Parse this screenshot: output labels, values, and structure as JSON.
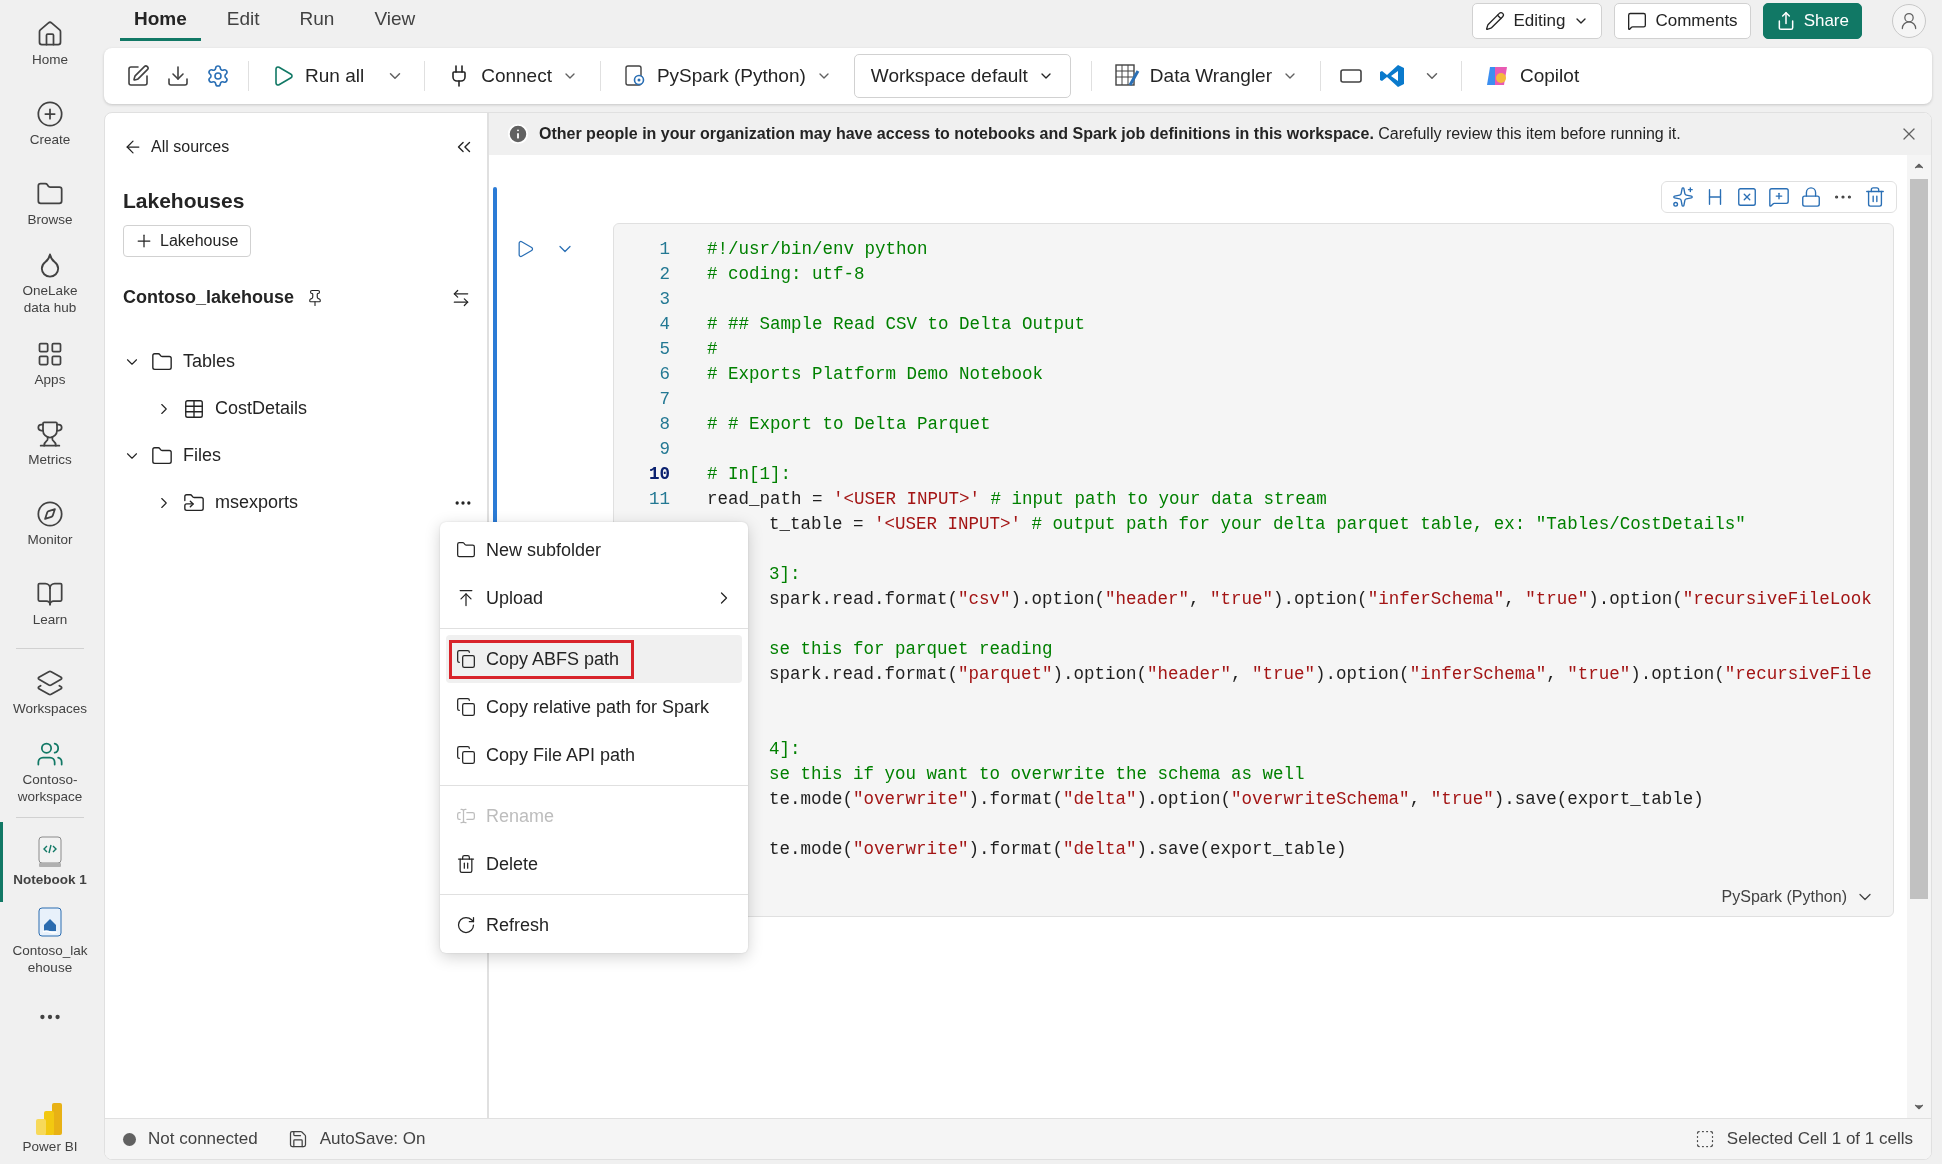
{
  "nav_rail": {
    "items": [
      {
        "label": "Home",
        "selected": false
      },
      {
        "label": "Create",
        "selected": false
      },
      {
        "label": "Browse",
        "selected": false
      },
      {
        "label": "OneLake data hub",
        "selected": false
      },
      {
        "label": "Apps",
        "selected": false
      },
      {
        "label": "Metrics",
        "selected": false
      },
      {
        "label": "Monitor",
        "selected": false
      },
      {
        "label": "Learn",
        "selected": false
      },
      {
        "kind": "divider"
      },
      {
        "label": "Workspaces",
        "selected": false
      },
      {
        "label": "Contoso-workspace",
        "selected": false
      },
      {
        "kind": "divider"
      },
      {
        "label": "Notebook 1",
        "selected": true
      },
      {
        "label": "Contoso_lakehouse",
        "selected": false
      }
    ],
    "footer": {
      "label": "Power BI"
    }
  },
  "menu_tabs": [
    {
      "label": "Home",
      "selected": true
    },
    {
      "label": "Edit",
      "selected": false
    },
    {
      "label": "Run",
      "selected": false
    },
    {
      "label": "View",
      "selected": false
    }
  ],
  "header_actions": [
    {
      "label": "Editing",
      "kind": "dropdown"
    },
    {
      "label": "Comments",
      "kind": "plain"
    },
    {
      "label": "Share",
      "kind": "primary"
    }
  ],
  "toolbar": [
    {
      "kind": "icon"
    },
    {
      "kind": "icon"
    },
    {
      "kind": "icon"
    },
    {
      "kind": "separator"
    },
    {
      "kind": "split",
      "label": "Run all"
    },
    {
      "kind": "separator"
    },
    {
      "kind": "button",
      "label": "Connect",
      "caret": true
    },
    {
      "kind": "separator"
    },
    {
      "kind": "button",
      "label": "PySpark (Python)",
      "caret": true
    },
    {
      "kind": "select",
      "label": "Workspace default"
    },
    {
      "kind": "separator"
    },
    {
      "kind": "button",
      "label": "Data Wrangler",
      "caret": true
    },
    {
      "kind": "separator"
    },
    {
      "kind": "icon"
    },
    {
      "kind": "split_icon"
    },
    {
      "kind": "separator"
    },
    {
      "kind": "button",
      "label": "Copilot",
      "caret": false
    }
  ],
  "explorer": {
    "back_link": "All sources",
    "section_title": "Lakehouses",
    "add_button": "Lakehouse",
    "lakehouse_name": "Contoso_lakehouse",
    "tree": [
      {
        "label": "Tables",
        "kind": "folder",
        "expanded": true,
        "children": [
          {
            "label": "CostDetails",
            "kind": "table",
            "expanded": false
          }
        ]
      },
      {
        "label": "Files",
        "kind": "folder",
        "expanded": true,
        "children": [
          {
            "label": "msexports",
            "kind": "shortcut",
            "expanded": false,
            "active": true
          }
        ]
      }
    ]
  },
  "banner": {
    "bold_text": "Other people in your organization may have access to notebooks and Spark job definitions in this workspace.",
    "text": "Carefully review this item before running it."
  },
  "cell": {
    "language": "PySpark (Python)",
    "lines": [
      {
        "number": "1",
        "kind": "comment",
        "text": "#!/usr/bin/env python",
        "current": false
      },
      {
        "number": "2",
        "kind": "comment",
        "text": "# coding: utf-8",
        "current": false
      },
      {
        "number": "3",
        "kind": "blank",
        "current": false
      },
      {
        "number": "4",
        "kind": "comment",
        "text": "# ## Sample Read CSV to Delta Output",
        "current": false
      },
      {
        "number": "5",
        "kind": "comment",
        "text": "#",
        "current": false
      },
      {
        "number": "6",
        "kind": "comment",
        "text": "# Exports Platform Demo Notebook",
        "current": false
      },
      {
        "number": "7",
        "kind": "blank",
        "current": false
      },
      {
        "number": "8",
        "kind": "comment",
        "text": "# # Export to Delta Parquet",
        "current": false
      },
      {
        "number": "9",
        "kind": "blank",
        "current": false
      },
      {
        "number": "10",
        "kind": "comment",
        "text": "# In[1]:",
        "current": true
      },
      {
        "number": "11",
        "kind": "code",
        "text": "read_path = '<USER INPUT>' # input path to your data stream",
        "current": false
      },
      {
        "kind": "code",
        "partial": true,
        "text": "t_table = '<USER INPUT>' # output path for your delta parquet table, ex: \"Tables/CostDetails\""
      },
      {
        "kind": "blank"
      },
      {
        "kind": "comment",
        "partial": true,
        "text": "3]:"
      },
      {
        "kind": "code",
        "partial": true,
        "text": "spark.read.format(\"csv\").option(\"header\", \"true\").option(\"inferSchema\", \"true\").option(\"recursiveFileLook"
      },
      {
        "kind": "blank"
      },
      {
        "kind": "comment",
        "partial": true,
        "text": "se this for parquet reading"
      },
      {
        "kind": "code",
        "partial": true,
        "text": "spark.read.format(\"parquet\").option(\"header\", \"true\").option(\"inferSchema\", \"true\").option(\"recursiveFile"
      },
      {
        "kind": "blank"
      },
      {
        "kind": "blank"
      },
      {
        "kind": "comment",
        "partial": true,
        "text": "4]:"
      },
      {
        "kind": "comment",
        "partial": true,
        "text": "se this if you want to overwrite the schema as well"
      },
      {
        "kind": "code",
        "partial": true,
        "text": "te.mode(\"overwrite\").format(\"delta\").option(\"overwriteSchema\", \"true\").save(export_table)"
      },
      {
        "kind": "blank"
      },
      {
        "kind": "code",
        "partial": true,
        "text": "te.mode(\"overwrite\").format(\"delta\").save(export_table)"
      }
    ]
  },
  "context_menu": [
    {
      "kind": "item",
      "label": "New subfolder",
      "selected": false,
      "disabled": false
    },
    {
      "kind": "item",
      "label": "Upload",
      "submenu": true,
      "selected": false,
      "disabled": false
    },
    {
      "kind": "divider"
    },
    {
      "kind": "item",
      "label": "Copy ABFS path",
      "selected": true,
      "disabled": false
    },
    {
      "kind": "item",
      "label": "Copy relative path for Spark",
      "selected": false,
      "disabled": false
    },
    {
      "kind": "item",
      "label": "Copy File API path",
      "selected": false,
      "disabled": false
    },
    {
      "kind": "divider"
    },
    {
      "kind": "item",
      "label": "Rename",
      "selected": false,
      "disabled": true
    },
    {
      "kind": "item",
      "label": "Delete",
      "selected": false,
      "disabled": false
    },
    {
      "kind": "divider"
    },
    {
      "kind": "item",
      "label": "Refresh",
      "selected": false,
      "disabled": false
    }
  ],
  "status_bar": {
    "connection": "Not connected",
    "connected": false,
    "autosave": "AutoSave: On",
    "selection": "Selected Cell 1 of 1 cells"
  }
}
